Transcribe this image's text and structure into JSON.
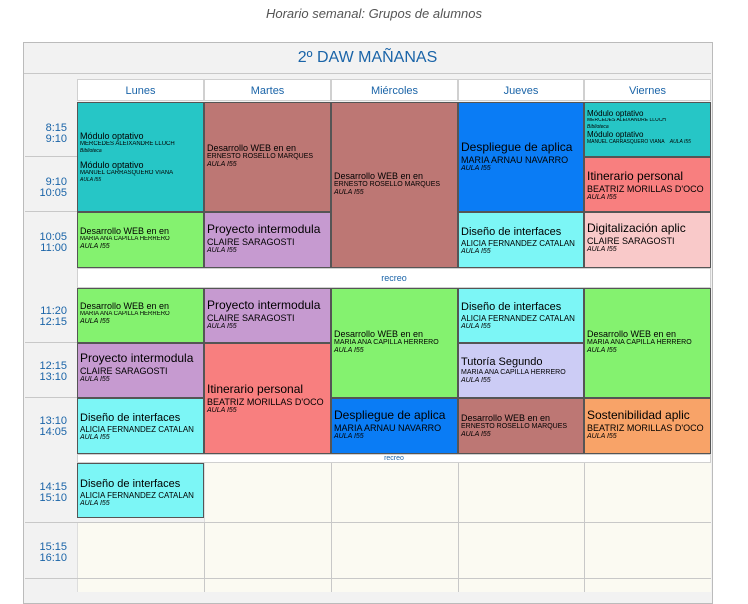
{
  "page_title": "Horario semanal: Grupos de alumnos",
  "group": "2º DAW MAÑANAS",
  "days": [
    "Lunes",
    "Martes",
    "Miércoles",
    "Jueves",
    "Viernes"
  ],
  "times": {
    "t1": [
      "8:15",
      "9:10"
    ],
    "t2": [
      "9:10",
      "10:05"
    ],
    "t3": [
      "10:05",
      "11:00"
    ],
    "t4": [
      "11:20",
      "12:15"
    ],
    "t5": [
      "12:15",
      "13:10"
    ],
    "t6": [
      "13:10",
      "14:05"
    ],
    "t7": [
      "14:15",
      "15:10"
    ],
    "t8": [
      "15:15",
      "16:10"
    ]
  },
  "breaks": {
    "b1": "recreo",
    "b2": "recreo"
  },
  "colors": {
    "teal": "#26c6c6",
    "rose": "#bd7774",
    "blue": "#0a7cf5",
    "red": "#f87f7f",
    "green": "#84f26f",
    "lilac": "#c69ad0",
    "cyan": "#7cf6f6",
    "pink": "#f9c9c9",
    "lavender": "#ccccf5",
    "orange": "#f8a368"
  },
  "cells": {
    "lun_mo1": {
      "subject": "Módulo optativo",
      "teacher": "MERCEDES ALEIXANDRE LLUCH",
      "room": "Biblioteca"
    },
    "lun_mo2": {
      "subject": "Módulo optativo",
      "teacher": "MANUEL CARRASQUERO VIANA",
      "room": "AULA I55"
    },
    "lun_web1": {
      "subject": "Desarrollo WEB en en",
      "teacher": "MARIA ANA CAPILLA HERRERO",
      "room": "AULA I55"
    },
    "lun_web2": {
      "subject": "Desarrollo WEB en en",
      "teacher": "MARIA ANA CAPILLA HERRERO",
      "room": "AULA I55"
    },
    "lun_proy": {
      "subject": "Proyecto intermodula",
      "teacher": "CLAIRE SARAGOSTI",
      "room": "AULA I55"
    },
    "lun_dis1": {
      "subject": "Diseño de interfaces",
      "teacher": "ALICIA FERNANDEZ CATALAN",
      "room": "AULA I55"
    },
    "lun_dis2": {
      "subject": "Diseño de interfaces",
      "teacher": "ALICIA FERNANDEZ CATALAN",
      "room": "AULA I55"
    },
    "mar_web": {
      "subject": "Desarrollo WEB en en",
      "teacher": "ERNESTO ROSELLO MARQUES",
      "room": "AULA I55"
    },
    "mar_proy1": {
      "subject": "Proyecto intermodula",
      "teacher": "CLAIRE SARAGOSTI",
      "room": "AULA I55"
    },
    "mar_proy2": {
      "subject": "Proyecto intermodula",
      "teacher": "CLAIRE SARAGOSTI",
      "room": "AULA I55"
    },
    "mar_itin": {
      "subject": "Itinerario personal",
      "teacher": "BEATRIZ MORILLAS D'OCO",
      "room": "AULA I55"
    },
    "mie_web1": {
      "subject": "Desarrollo WEB en en",
      "teacher": "ERNESTO ROSELLO MARQUES",
      "room": "AULA I55"
    },
    "mie_web2": {
      "subject": "Desarrollo WEB en en",
      "teacher": "MARIA ANA CAPILLA HERRERO",
      "room": "AULA I55"
    },
    "mie_desp": {
      "subject": "Despliegue de aplica",
      "teacher": "MARIA ARNAU NAVARRO",
      "room": "AULA I55"
    },
    "jue_desp": {
      "subject": "Despliegue de aplica",
      "teacher": "MARIA ARNAU NAVARRO",
      "room": "AULA I55"
    },
    "jue_dis1": {
      "subject": "Diseño de interfaces",
      "teacher": "ALICIA FERNANDEZ CATALAN",
      "room": "AULA I55"
    },
    "jue_dis2": {
      "subject": "Diseño de interfaces",
      "teacher": "ALICIA FERNANDEZ CATALAN",
      "room": "AULA I55"
    },
    "jue_tut": {
      "subject": "Tutoría Segundo",
      "teacher": "MARIA ANA CAPILLA HERRERO",
      "room": "AULA I55"
    },
    "jue_web": {
      "subject": "Desarrollo WEB en en",
      "teacher": "ERNESTO ROSELLO MARQUES",
      "room": "AULA I55"
    },
    "vie_mo1": {
      "subject": "Módulo optativo",
      "teacher": "MERCEDES ALEIXANDRE LLUCH",
      "room": "Biblioteca"
    },
    "vie_mo2": {
      "subject": "Módulo optativo",
      "teacher": "MANUEL CARRASQUERO VIANA",
      "room": "AULA I55"
    },
    "vie_itin": {
      "subject": "Itinerario personal",
      "teacher": "BEATRIZ MORILLAS D'OCO",
      "room": "AULA I55"
    },
    "vie_dig": {
      "subject": "Digitalización aplic",
      "teacher": "CLAIRE SARAGOSTI",
      "room": "AULA I55"
    },
    "vie_web": {
      "subject": "Desarrollo WEB en en",
      "teacher": "MARIA ANA CAPILLA HERRERO",
      "room": "AULA I55"
    },
    "vie_sost": {
      "subject": "Sostenibilidad aplic",
      "teacher": "BEATRIZ MORILLAS D'OCO",
      "room": "AULA I55"
    }
  }
}
